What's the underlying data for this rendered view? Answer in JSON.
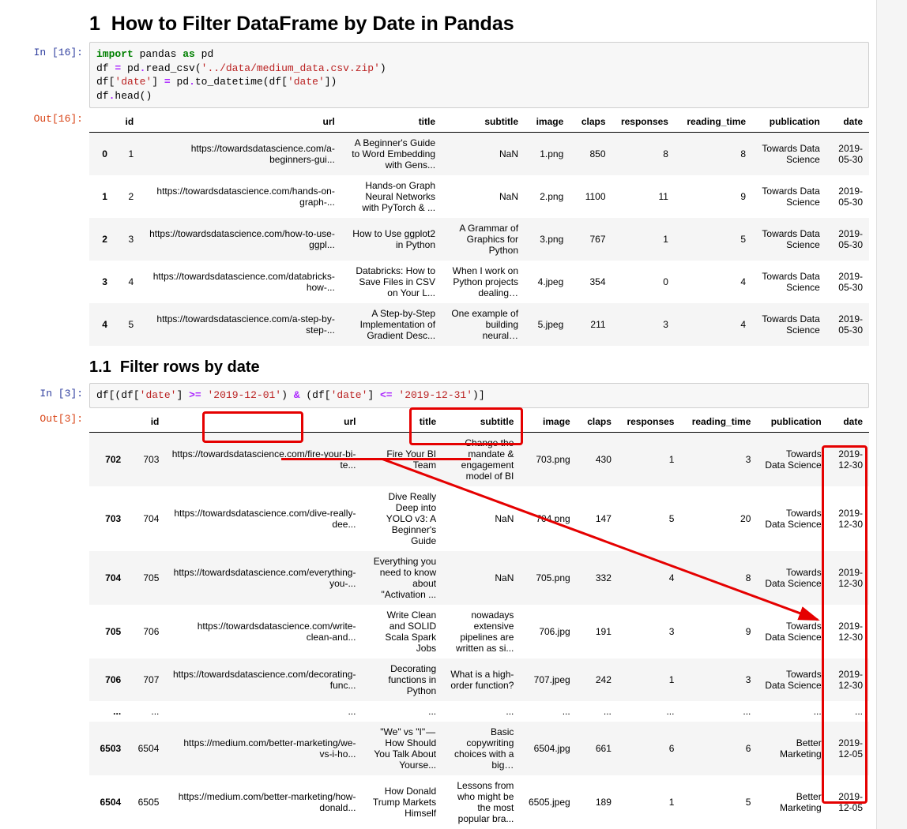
{
  "heading1": "1  How to Filter DataFrame by Date in Pandas",
  "cell1": {
    "prompt_in": "In [16]:",
    "prompt_out": "Out[16]:",
    "code_tokens": [
      [
        "kw",
        "import"
      ],
      [
        "nm",
        " pandas "
      ],
      [
        "kw",
        "as"
      ],
      [
        "nm",
        " pd\n"
      ],
      [
        "nm",
        "df "
      ],
      [
        "op",
        "="
      ],
      [
        "nm",
        " pd"
      ],
      [
        "op",
        "."
      ],
      [
        "nm",
        "read_csv"
      ],
      [
        "pn",
        "("
      ],
      [
        "str",
        "'../data/medium_data.csv.zip'"
      ],
      [
        "pn",
        ")\n"
      ],
      [
        "nm",
        "df"
      ],
      [
        "pn",
        "["
      ],
      [
        "str",
        "'date'"
      ],
      [
        "pn",
        "] "
      ],
      [
        "op",
        "="
      ],
      [
        "nm",
        " pd"
      ],
      [
        "op",
        "."
      ],
      [
        "nm",
        "to_datetime"
      ],
      [
        "pn",
        "("
      ],
      [
        "nm",
        "df"
      ],
      [
        "pn",
        "["
      ],
      [
        "str",
        "'date'"
      ],
      [
        "pn",
        "])\n"
      ],
      [
        "nm",
        "df"
      ],
      [
        "op",
        "."
      ],
      [
        "nm",
        "head"
      ],
      [
        "pn",
        "()"
      ]
    ],
    "columns": [
      "",
      "id",
      "url",
      "title",
      "subtitle",
      "image",
      "claps",
      "responses",
      "reading_time",
      "publication",
      "date"
    ],
    "rows": [
      {
        "_idx": "0",
        "id": "1",
        "url": "https://towardsdatascience.com/a-beginners-gui...",
        "title": "A Beginner's Guide to Word Embedding with Gens...",
        "subtitle": "NaN",
        "image": "1.png",
        "claps": "850",
        "responses": "8",
        "reading_time": "8",
        "publication": "Towards Data Science",
        "date": "2019-05-30"
      },
      {
        "_idx": "1",
        "id": "2",
        "url": "https://towardsdatascience.com/hands-on-graph-...",
        "title": "Hands-on Graph Neural Networks with PyTorch & ...",
        "subtitle": "NaN",
        "image": "2.png",
        "claps": "1100",
        "responses": "11",
        "reading_time": "9",
        "publication": "Towards Data Science",
        "date": "2019-05-30"
      },
      {
        "_idx": "2",
        "id": "3",
        "url": "https://towardsdatascience.com/how-to-use-ggpl...",
        "title": "How to Use ggplot2 in Python",
        "subtitle": "A Grammar of Graphics for Python",
        "image": "3.png",
        "claps": "767",
        "responses": "1",
        "reading_time": "5",
        "publication": "Towards Data Science",
        "date": "2019-05-30"
      },
      {
        "_idx": "3",
        "id": "4",
        "url": "https://towardsdatascience.com/databricks-how-...",
        "title": "Databricks: How to Save Files in CSV on Your L...",
        "subtitle": "When I work on Python projects dealing…",
        "image": "4.jpeg",
        "claps": "354",
        "responses": "0",
        "reading_time": "4",
        "publication": "Towards Data Science",
        "date": "2019-05-30"
      },
      {
        "_idx": "4",
        "id": "5",
        "url": "https://towardsdatascience.com/a-step-by-step-...",
        "title": "A Step-by-Step Implementation of Gradient Desc...",
        "subtitle": "One example of building neural…",
        "image": "5.jpeg",
        "claps": "211",
        "responses": "3",
        "reading_time": "4",
        "publication": "Towards Data Science",
        "date": "2019-05-30"
      }
    ]
  },
  "heading2": "1.1  Filter rows by date",
  "cell2": {
    "prompt_in": "In [3]:",
    "prompt_out": "Out[3]:",
    "code_tokens": [
      [
        "nm",
        "df"
      ],
      [
        "pn",
        "[("
      ],
      [
        "nm",
        "df"
      ],
      [
        "pn",
        "["
      ],
      [
        "str",
        "'date'"
      ],
      [
        "pn",
        "] "
      ],
      [
        "op",
        ">="
      ],
      [
        "nm",
        " "
      ],
      [
        "str",
        "'2019-12-01'"
      ],
      [
        "pn",
        ") "
      ],
      [
        "op",
        "&"
      ],
      [
        "pn",
        " ("
      ],
      [
        "nm",
        "df"
      ],
      [
        "pn",
        "["
      ],
      [
        "str",
        "'date'"
      ],
      [
        "pn",
        "] "
      ],
      [
        "op",
        "<="
      ],
      [
        "nm",
        " "
      ],
      [
        "str",
        "'2019-12-31'"
      ],
      [
        "pn",
        ")]"
      ]
    ],
    "columns": [
      "",
      "id",
      "url",
      "title",
      "subtitle",
      "image",
      "claps",
      "responses",
      "reading_time",
      "publication",
      "date"
    ],
    "rows": [
      {
        "_idx": "702",
        "id": "703",
        "url": "https://towardsdatascience.com/fire-your-bi-te...",
        "title": "Fire Your BI Team",
        "subtitle": "Change the mandate & engagement model of BI",
        "image": "703.png",
        "claps": "430",
        "responses": "1",
        "reading_time": "3",
        "publication": "Towards Data Science",
        "date": "2019-12-30"
      },
      {
        "_idx": "703",
        "id": "704",
        "url": "https://towardsdatascience.com/dive-really-dee...",
        "title": "Dive Really Deep into YOLO v3: A Beginner's Guide",
        "subtitle": "NaN",
        "image": "704.png",
        "claps": "147",
        "responses": "5",
        "reading_time": "20",
        "publication": "Towards Data Science",
        "date": "2019-12-30"
      },
      {
        "_idx": "704",
        "id": "705",
        "url": "https://towardsdatascience.com/everything-you-...",
        "title": "Everything you need to know about \"Activation ...",
        "subtitle": "NaN",
        "image": "705.png",
        "claps": "332",
        "responses": "4",
        "reading_time": "8",
        "publication": "Towards Data Science",
        "date": "2019-12-30"
      },
      {
        "_idx": "705",
        "id": "706",
        "url": "https://towardsdatascience.com/write-clean-and...",
        "title": "Write Clean and SOLID Scala Spark Jobs",
        "subtitle": "nowadays extensive pipelines are written as si...",
        "image": "706.jpg",
        "claps": "191",
        "responses": "3",
        "reading_time": "9",
        "publication": "Towards Data Science",
        "date": "2019-12-30"
      },
      {
        "_idx": "706",
        "id": "707",
        "url": "https://towardsdatascience.com/decorating-func...",
        "title": "Decorating functions in Python",
        "subtitle": "What is a high-order function?",
        "image": "707.jpeg",
        "claps": "242",
        "responses": "1",
        "reading_time": "3",
        "publication": "Towards Data Science",
        "date": "2019-12-30"
      },
      {
        "_idx": "...",
        "id": "...",
        "url": "...",
        "title": "...",
        "subtitle": "...",
        "image": "...",
        "claps": "...",
        "responses": "...",
        "reading_time": "...",
        "publication": "...",
        "date": "..."
      },
      {
        "_idx": "6503",
        "id": "6504",
        "url": "https://medium.com/better-marketing/we-vs-i-ho...",
        "title": "\"We\" vs \"I\" — How Should You Talk About Yourse...",
        "subtitle": "Basic copywriting choices with a big…",
        "image": "6504.jpg",
        "claps": "661",
        "responses": "6",
        "reading_time": "6",
        "publication": "Better Marketing",
        "date": "2019-12-05"
      },
      {
        "_idx": "6504",
        "id": "6505",
        "url": "https://medium.com/better-marketing/how-donald...",
        "title": "How Donald Trump Markets Himself",
        "subtitle": "Lessons from who might be the most popular bra...",
        "image": "6505.jpeg",
        "claps": "189",
        "responses": "1",
        "reading_time": "5",
        "publication": "Better Marketing",
        "date": "2019-12-05"
      }
    ]
  },
  "col_widths_1": {
    "_idx": "26px",
    "id": "26px",
    "url": "250px",
    "title": "150px",
    "subtitle": "140px",
    "image": "50px",
    "claps": "46px",
    "responses": "68px",
    "reading_time": "92px",
    "publication": "96px",
    "date": "48px"
  },
  "col_widths_2": {
    "_idx": "42px",
    "id": "42px",
    "url": "236px",
    "title": "135px",
    "subtitle": "110px",
    "image": "60px",
    "claps": "46px",
    "responses": "70px",
    "reading_time": "92px",
    "publication": "90px",
    "date": "46px"
  }
}
